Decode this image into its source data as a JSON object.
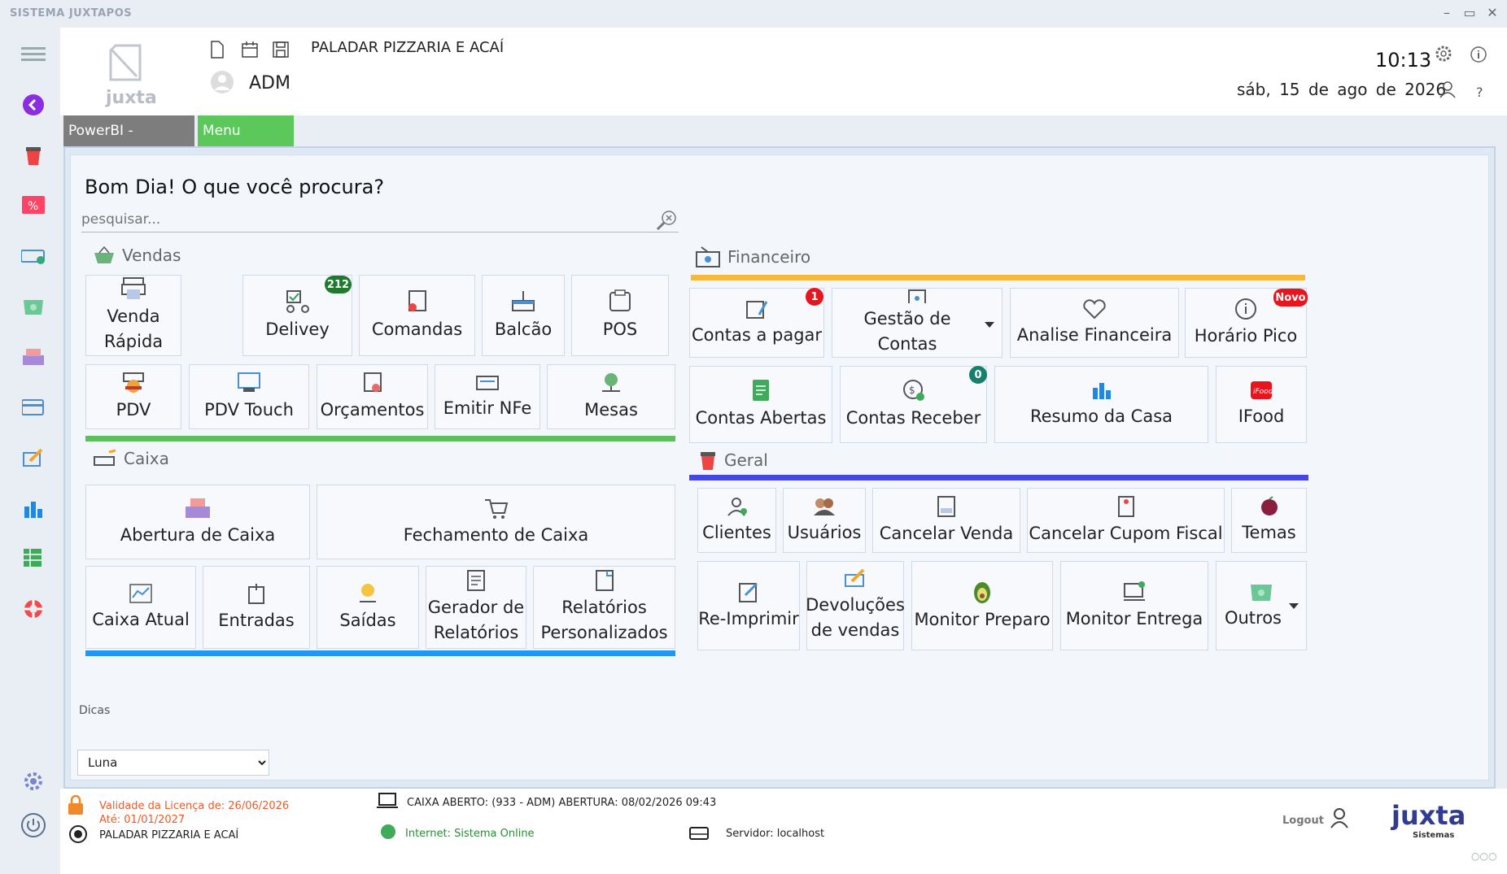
{
  "window": {
    "title": "SISTEMA JUXTAPOS"
  },
  "header": {
    "logo_text": "juxta",
    "company": "PALADAR PIZZARIA E ACAÍ",
    "user": "ADM",
    "time": "10:13",
    "date": "sáb, 15 de ago de 2026"
  },
  "tabs": [
    {
      "label": "PowerBI - Analítico"
    },
    {
      "label": "Menu Rápido"
    }
  ],
  "greeting": "Bom Dia! O que você procura?",
  "search": {
    "placeholder": "pesquisar..."
  },
  "vendas": {
    "title": "Vendas",
    "buttons": [
      "Venda Rápida",
      "Delivey",
      "Comandas",
      "Balcão",
      "POS",
      "PDV",
      "PDV Touch",
      "Orçamentos",
      "Emitir NFe",
      "Mesas"
    ],
    "delivery_badge": "212"
  },
  "caixa": {
    "title": "Caixa",
    "buttons": [
      "Abertura de Caixa",
      "Fechamento de Caixa",
      "Caixa Atual",
      "Entradas",
      "Saídas",
      "Gerador de Relatórios",
      "Relatórios Personalizados"
    ]
  },
  "financeiro": {
    "title": "Financeiro",
    "buttons": [
      "Contas a pagar",
      "Gestão de Contas",
      "Analise  Financeira",
      "Horário Pico",
      "Contas Abertas",
      "Contas Receber",
      "Resumo da Casa",
      "IFood"
    ],
    "contas_pagar_badge": "1",
    "horario_badge": "Novo",
    "receber_badge": "0"
  },
  "geral": {
    "title": "Geral",
    "buttons": [
      "Clientes",
      "Usuários",
      "Cancelar Venda",
      "Cancelar Cupom Fiscal",
      "Temas",
      "Re-Imprimir",
      "Devoluções de vendas",
      "Monitor Preparo",
      "Monitor Entrega",
      "Outros"
    ]
  },
  "dicas": {
    "label": "Dicas"
  },
  "theme": {
    "selected": "Luna"
  },
  "status": {
    "license": "Validade da Licença de: 26/06/2026",
    "license_until": "Até: 01/01/2027",
    "company": "PALADAR PIZZARIA E ACAÍ",
    "caixa": "CAIXA ABERTO: (933 - ADM) ABERTURA: 08/02/2026 09:43",
    "internet": "Internet: Sistema Online",
    "server": "Servidor: localhost",
    "logout": "Logout",
    "brand": "juxta",
    "brand_sub": "Sistemas"
  },
  "colors": {
    "vendas_bar": "#5cbf5c",
    "caixa_bar": "#2196f3",
    "financeiro_bar": "#f5b93e",
    "geral_bar": "#4646e0",
    "tab_active": "#5cc85c",
    "badge_green": "#1f7a2e",
    "badge_red": "#e8141e",
    "license_text": "#f05a28"
  },
  "icons": [
    "hamburger-icon",
    "back-icon",
    "cup-icon",
    "percent-icon",
    "card-reader-icon",
    "money-icon",
    "register-icon",
    "wallet-icon",
    "edit-icon",
    "bar-chart-icon",
    "spreadsheet-icon",
    "lifebuoy-icon",
    "gear-icon",
    "power-icon"
  ]
}
